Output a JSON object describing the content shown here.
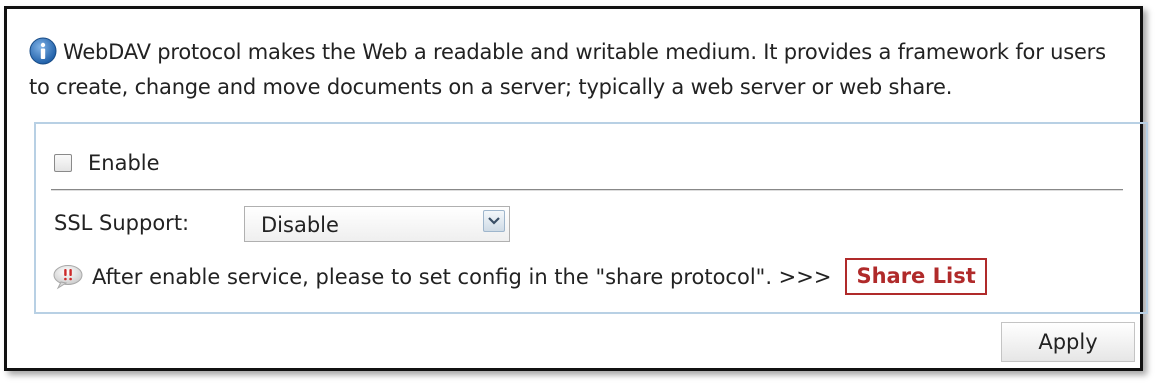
{
  "info": {
    "icon": "info-icon",
    "text": "WebDAV protocol makes the Web a readable and writable medium. It provides a framework for users to create, change and move documents on a server; typically a web server or web share."
  },
  "enable": {
    "label": "Enable",
    "checked": false
  },
  "ssl": {
    "label": "SSL Support:",
    "value": "Disable"
  },
  "notice": {
    "icon": "warning-bubble-icon",
    "text": "After enable service, please to set config in the \"share protocol\". >>>",
    "link_label": "Share List",
    "link_color": "#b02a2a"
  },
  "actions": {
    "apply_label": "Apply"
  },
  "colors": {
    "panel_border": "#b8d0e4",
    "info_icon": "#2f6fb6"
  }
}
